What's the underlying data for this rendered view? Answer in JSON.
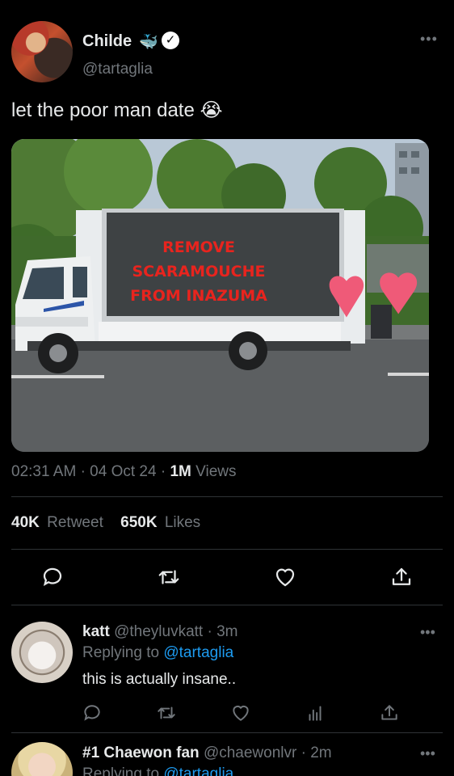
{
  "tweet": {
    "display_name": "Childe",
    "name_emoji": "🐳",
    "verified_mark": "✓",
    "handle": "@tartaglia",
    "more_label": "•••",
    "text": "let the poor man date 😭",
    "image_sign_text": [
      "REMOVE",
      "SCARAMOUCHE",
      "FROM INAZUMA"
    ],
    "time": "02:31 AM",
    "dot": "·",
    "date": "04 Oct 24",
    "views_count": "1M",
    "views_label": "Views",
    "retweets_count": "40K",
    "retweets_label": "Retweet",
    "likes_count": "650K",
    "likes_label": "Likes"
  },
  "actions": {
    "icons": [
      "reply-icon",
      "retweet-icon",
      "like-icon",
      "share-icon"
    ]
  },
  "replies": [
    {
      "name": "katt",
      "handle": "@theyluvkatt",
      "time": "3m",
      "replying_prefix": "Replying to",
      "replying_to": "@tartaglia",
      "text": "this is actually insane..",
      "more_label": "•••",
      "icons": [
        "reply-icon",
        "retweet-icon",
        "like-icon",
        "analytics-icon",
        "share-icon"
      ]
    },
    {
      "name": "#1 Chaewon fan",
      "handle": "@chaewonlvr",
      "time": "2m",
      "replying_prefix": "Replying to",
      "replying_to": "@tartaglia",
      "more_label": "•••"
    }
  ],
  "colors": {
    "background": "#000000",
    "text": "#e7e9ea",
    "secondary": "#71767b",
    "link": "#1d9bf0",
    "divider": "#2f3336",
    "sign_text": "#e8241e",
    "heart": "#ef5a78"
  }
}
